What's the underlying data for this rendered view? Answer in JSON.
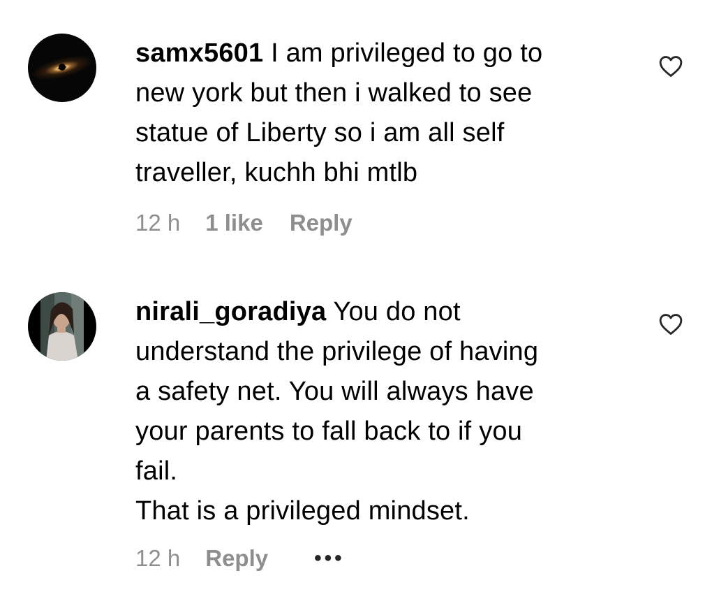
{
  "comments": [
    {
      "username": "samx5601",
      "text_lines": [
        " I am privileged to go to",
        "new york but then i walked to see",
        "statue of Liberty so i am all self",
        "traveller, kuchh bhi mtlb"
      ],
      "time": "12 h",
      "likes": "1 like",
      "reply": "Reply",
      "avatar_icon": "black-hole-avatar",
      "like_icon": "heart-outline-icon"
    },
    {
      "username": "nirali_goradiya",
      "text_lines": [
        " You do not",
        "understand the privilege of having",
        "a safety net. You will always have",
        "your parents to fall back to if you",
        "fail.",
        "That is a privileged mindset."
      ],
      "time": "12 h",
      "reply": "Reply",
      "more": "•••",
      "avatar_icon": "profile-photo-avatar",
      "like_icon": "heart-outline-icon"
    }
  ],
  "colors": {
    "text": "#000000",
    "meta": "#8e8e8e",
    "icon": "#262626"
  }
}
